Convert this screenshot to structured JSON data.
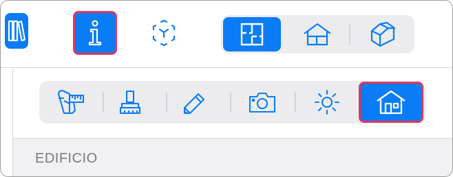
{
  "top_toolbar": {
    "library_icon": "books-icon",
    "info_icon": "info-icon",
    "ar_icon": "ar-cube-icon",
    "view_modes": [
      {
        "id": "floor-plan",
        "icon": "floor-plan-icon",
        "selected": true
      },
      {
        "id": "house-section",
        "icon": "house-section-icon",
        "selected": false
      },
      {
        "id": "3d-view",
        "icon": "3d-box-icon",
        "selected": false
      }
    ]
  },
  "tool_bar": {
    "tools": [
      {
        "id": "measure",
        "icon": "caliper-icon",
        "selected": false
      },
      {
        "id": "style",
        "icon": "stamp-icon",
        "selected": false
      },
      {
        "id": "edit",
        "icon": "pencil-icon",
        "selected": false
      },
      {
        "id": "camera",
        "icon": "camera-icon",
        "selected": false
      },
      {
        "id": "light",
        "icon": "sun-icon",
        "selected": false
      },
      {
        "id": "building",
        "icon": "house-icon",
        "selected": true
      }
    ]
  },
  "panel": {
    "section_title": "EDIFICIO"
  },
  "colors": {
    "accent": "#0a7cf5",
    "highlight": "#e0375f",
    "segment_bg": "#ececef"
  }
}
